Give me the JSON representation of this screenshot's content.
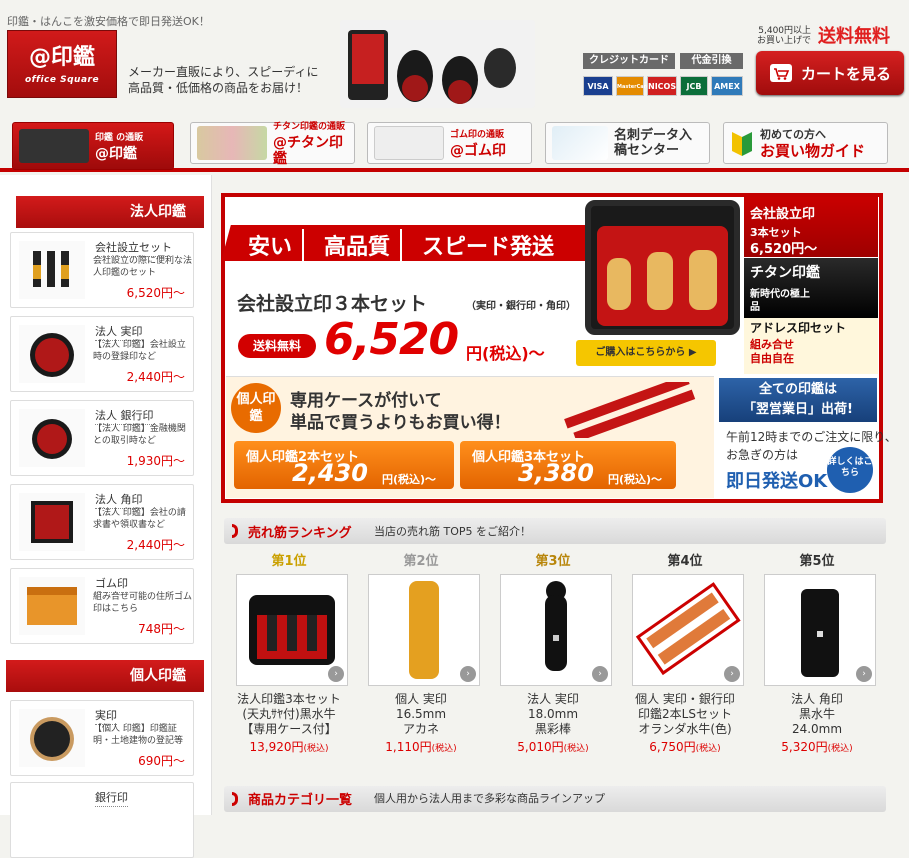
{
  "header": {
    "tagline": "印鑑・はんこを激安価格で即日発送OK！",
    "logo_main": "@印鑑",
    "logo_sub": "office Square",
    "intro_line1": "メーカー直販により、スピーディに",
    "intro_line2": "高品質・低価格の商品をお届け！",
    "free_ship_note1": "5,400円以上",
    "free_ship_note2": "お買い上げで",
    "free_ship": "送料無料",
    "pay_card": "クレジットカード",
    "pay_cod": "代金引換",
    "cards": [
      "VISA",
      "MasterCard",
      "NICOS",
      "JCB",
      "AMEX"
    ],
    "cart_button": "カートを見る"
  },
  "nav": [
    {
      "sub": "印鑑 の通販",
      "main": "@印鑑"
    },
    {
      "sub": "チタン印鑑の通販",
      "main": "@チタン印鑑"
    },
    {
      "sub": "ゴム印の通販",
      "main": "@ゴム印"
    },
    {
      "sub": "",
      "main": "名刺データ入稿センター"
    },
    {
      "sub": "初めての方へ",
      "main": "お買い物ガイド"
    }
  ],
  "sidebar": {
    "section1": "法人印鑑",
    "items": [
      {
        "name": "会社設立セット",
        "desc": "会社設立の際に便利な法人印鑑のセット",
        "price": "6,520円〜"
      },
      {
        "name": "法人 実印",
        "desc": "【法人 印鑑】会社設立時の登録印など",
        "price": "2,440円〜"
      },
      {
        "name": "法人 銀行印",
        "desc": "【法人 印鑑】金融機関との取引時など",
        "price": "1,930円〜"
      },
      {
        "name": "法人 角印",
        "desc": "【法人 印鑑】会社の請求書や領収書など",
        "price": "2,440円〜"
      },
      {
        "name": "ゴム印",
        "desc": "組み合せ可能の住所ゴム印はこちら",
        "price": "748円〜"
      }
    ],
    "section2": "個人印鑑",
    "items2": [
      {
        "name": "実印",
        "desc": "【個人 印鑑】印鑑証明・土地建物の登記等",
        "price": "690円〜"
      },
      {
        "name": "銀行印",
        "desc": "",
        "price": ""
      }
    ]
  },
  "banner": {
    "strip": [
      "安い",
      "高品質",
      "スピード発送"
    ],
    "set_name": "会社設立印３本セット",
    "set_sub": "（実印・銀行印・角印）",
    "ship_badge": "送料無料",
    "price": "6,520",
    "price_suffix": "円(税込)〜",
    "buy_button": "ご購入はこちらから ▶",
    "side1_title": "会社設立印",
    "side1_sub": "3本セット",
    "side1_price": "6,520円〜",
    "side2_title": "チタン印鑑",
    "side2_sub": "新時代の極上品",
    "side3_title": "アドレス印セット",
    "side3_sub": "組み合せ自由自在",
    "personal_badge": "個人印鑑",
    "personal_l1": "専用ケースが付いて",
    "personal_l2": "単品で買うよりもお買い得！",
    "set2_title": "個人印鑑2本セット",
    "set2_price": "2,430",
    "set3_title": "個人印鑑3本セット",
    "set3_price": "3,380",
    "set_suffix": "円(税込)〜",
    "nextday_head1": "全ての印鑑は",
    "nextday_head2": "「翌営業日」出荷!",
    "nextday_t1": "午前12時までのご注文に限り、",
    "nextday_t2": "お急ぎの方は",
    "nextday_ok": "即日発送OK",
    "nextday_detail": "詳しくはこちら"
  },
  "ranking": {
    "title": "売れ筋ランキング",
    "subtitle": "当店の売れ筋 TOP5 をご紹介！",
    "items": [
      {
        "rank": "第1位",
        "name1": "法人印鑑3本セット",
        "name2": "(天丸ｻﾔ付)黒水牛",
        "name3": "【専用ケース付】",
        "price": "13,920円",
        "tax": "(税込)"
      },
      {
        "rank": "第2位",
        "name1": "個人 実印",
        "name2": "16.5mm",
        "name3": "アカネ",
        "price": "1,110円",
        "tax": "(税込)"
      },
      {
        "rank": "第3位",
        "name1": "法人 実印",
        "name2": "18.0mm",
        "name3": "黒彩棒",
        "price": "5,010円",
        "tax": "(税込)"
      },
      {
        "rank": "第4位",
        "name1": "個人 実印・銀行印",
        "name2": "印鑑2本LSセット",
        "name3": "オランダ水牛(色)",
        "price": "6,750円",
        "tax": "(税込)"
      },
      {
        "rank": "第5位",
        "name1": "法人 角印",
        "name2": "黒水牛",
        "name3": "24.0mm",
        "price": "5,320円",
        "tax": "(税込)"
      }
    ]
  },
  "category": {
    "title": "商品カテゴリ一覧",
    "subtitle": "個人用から法人用まで多彩な商品ラインアップ"
  }
}
